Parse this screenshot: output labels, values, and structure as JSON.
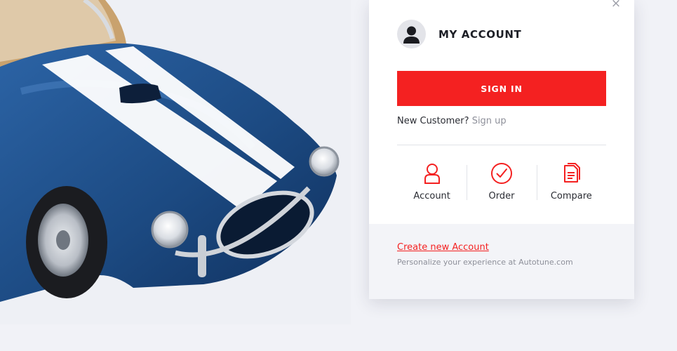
{
  "colors": {
    "accent": "#f42121",
    "page_bg": "#f1f2f7",
    "panel_bg": "#ffffff",
    "footer_bg": "#f3f4f8",
    "car_body": "#1f4f86",
    "car_stripe": "#ffffff"
  },
  "panel": {
    "close_icon": "×",
    "title": "MY ACCOUNT",
    "signin_label": "SIGN IN",
    "new_customer_text": "New Customer?",
    "signup_link": "Sign up",
    "shortcuts": [
      {
        "label": "Account",
        "icon": "user-icon"
      },
      {
        "label": "Order",
        "icon": "check-circle-icon"
      },
      {
        "label": "Compare",
        "icon": "compare-doc-icon"
      }
    ],
    "footer": {
      "create_link": "Create new Account",
      "tagline": "Personalize your experience at Autotune.com"
    }
  }
}
